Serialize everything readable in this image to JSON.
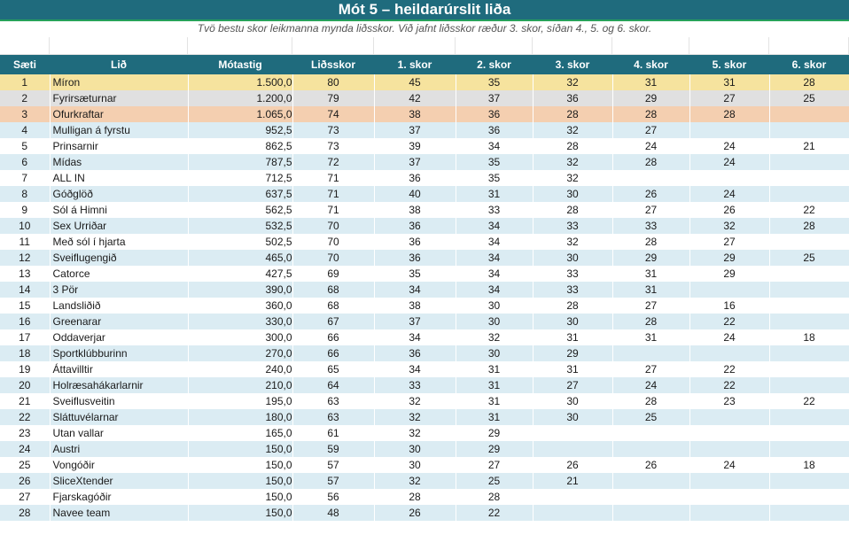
{
  "title": "Mót 5 – heildarúrslit liða",
  "subtitle": "Tvö bestu skor leikmanna mynda liðsskor. Við jafnt liðsskor ræður 3. skor, síðan 4., 5. og 6. skor.",
  "columns": [
    "Sæti",
    "Lið",
    "Mótastig",
    "Liðsskor",
    "1. skor",
    "2. skor",
    "3. skor",
    "4. skor",
    "5. skor",
    "6. skor"
  ],
  "rows": [
    [
      "1",
      "Míron",
      "1.500,0",
      "80",
      "45",
      "35",
      "32",
      "31",
      "31",
      "28"
    ],
    [
      "2",
      "Fyrirsæturnar",
      "1.200,0",
      "79",
      "42",
      "37",
      "36",
      "29",
      "27",
      "25"
    ],
    [
      "3",
      "Ofurkraftar",
      "1.065,0",
      "74",
      "38",
      "36",
      "28",
      "28",
      "28",
      ""
    ],
    [
      "4",
      "Mulligan á fyrstu",
      "952,5",
      "73",
      "37",
      "36",
      "32",
      "27",
      "",
      ""
    ],
    [
      "5",
      "Prinsarnir",
      "862,5",
      "73",
      "39",
      "34",
      "28",
      "24",
      "24",
      "21"
    ],
    [
      "6",
      "Mídas",
      "787,5",
      "72",
      "37",
      "35",
      "32",
      "28",
      "24",
      ""
    ],
    [
      "7",
      "ALL IN",
      "712,5",
      "71",
      "36",
      "35",
      "32",
      "",
      "",
      ""
    ],
    [
      "8",
      "Góðglöð",
      "637,5",
      "71",
      "40",
      "31",
      "30",
      "26",
      "24",
      ""
    ],
    [
      "9",
      "Sól á Himni",
      "562,5",
      "71",
      "38",
      "33",
      "28",
      "27",
      "26",
      "22"
    ],
    [
      "10",
      "Sex Urriðar",
      "532,5",
      "70",
      "36",
      "34",
      "33",
      "33",
      "32",
      "28"
    ],
    [
      "11",
      "Með sól í hjarta",
      "502,5",
      "70",
      "36",
      "34",
      "32",
      "28",
      "27",
      ""
    ],
    [
      "12",
      "Sveiflugengið",
      "465,0",
      "70",
      "36",
      "34",
      "30",
      "29",
      "29",
      "25"
    ],
    [
      "13",
      "Catorce",
      "427,5",
      "69",
      "35",
      "34",
      "33",
      "31",
      "29",
      ""
    ],
    [
      "14",
      "3 Pör",
      "390,0",
      "68",
      "34",
      "34",
      "33",
      "31",
      "",
      ""
    ],
    [
      "15",
      "Landsliðið",
      "360,0",
      "68",
      "38",
      "30",
      "28",
      "27",
      "16",
      ""
    ],
    [
      "16",
      "Greenarar",
      "330,0",
      "67",
      "37",
      "30",
      "30",
      "28",
      "22",
      ""
    ],
    [
      "17",
      "Oddaverjar",
      "300,0",
      "66",
      "34",
      "32",
      "31",
      "31",
      "24",
      "18"
    ],
    [
      "18",
      "Sportklúbburinn",
      "270,0",
      "66",
      "36",
      "30",
      "29",
      "",
      "",
      ""
    ],
    [
      "19",
      "Áttavilltir",
      "240,0",
      "65",
      "34",
      "31",
      "31",
      "27",
      "22",
      ""
    ],
    [
      "20",
      "Holræsahákarlarnir",
      "210,0",
      "64",
      "33",
      "31",
      "27",
      "24",
      "22",
      ""
    ],
    [
      "21",
      "Sveiflusveitin",
      "195,0",
      "63",
      "32",
      "31",
      "30",
      "28",
      "23",
      "22"
    ],
    [
      "22",
      "Sláttuvélarnar",
      "180,0",
      "63",
      "32",
      "31",
      "30",
      "25",
      "",
      ""
    ],
    [
      "23",
      "Utan vallar",
      "165,0",
      "61",
      "32",
      "29",
      "",
      "",
      "",
      ""
    ],
    [
      "24",
      "Austri",
      "150,0",
      "59",
      "30",
      "29",
      "",
      "",
      "",
      ""
    ],
    [
      "25",
      "Vongóðir",
      "150,0",
      "57",
      "30",
      "27",
      "26",
      "26",
      "24",
      "18"
    ],
    [
      "26",
      "SliceXtender",
      "150,0",
      "57",
      "32",
      "25",
      "21",
      "",
      "",
      ""
    ],
    [
      "27",
      "Fjarskagóðir",
      "150,0",
      "56",
      "28",
      "28",
      "",
      "",
      "",
      ""
    ],
    [
      "28",
      "Navee team",
      "150,0",
      "48",
      "26",
      "22",
      "",
      "",
      "",
      ""
    ]
  ],
  "colors": {
    "header": "#1f6b7d",
    "gold": "#f6e39e",
    "silver": "#e0e0e0",
    "bronze": "#f4cfb0",
    "stripe": "#dbecf3"
  }
}
